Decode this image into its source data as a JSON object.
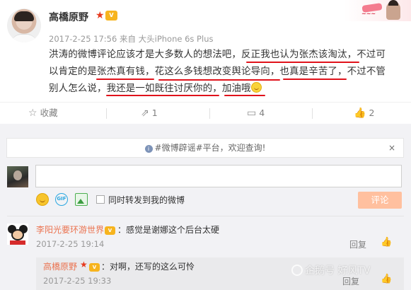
{
  "post": {
    "user_name": "高橋原野",
    "meta": "2017-2-25 17:56 来自 大头iPhone 6s Plus",
    "lines": [
      [
        "洪涛的微博评论应该才是大多数人的想法吧，",
        "反正我也认为张杰该淘汰",
        "，不过可"
      ],
      [
        "以肯定的是",
        "张杰真有钱",
        "，",
        "花这么多钱想改变舆论导向",
        "，",
        "也真是辛苦了",
        "，不过不管"
      ],
      [
        "别人怎么说，",
        "我还是一如既往讨厌你的",
        "，",
        "加油哦"
      ]
    ],
    "actions": {
      "favorite_label": "收藏",
      "repost_count": "1",
      "comment_count": "4",
      "like_count": "2"
    }
  },
  "notice": {
    "text": "#微博辟谣#平台，欢迎查询!",
    "close": "×"
  },
  "composer": {
    "gif_label": "GIF",
    "repost_label": "同时转发到我的微博",
    "submit_label": "评论"
  },
  "comments": [
    {
      "user": "李阳光要环游世界",
      "text": "：感觉是谢娜这个后台太硬",
      "time": "2017-2-25 19:14",
      "reply_label": "回复"
    },
    {
      "user": "高橋原野",
      "text": "：对啊，还写的这么可怜",
      "time": "2017-2-25 19:33",
      "reply_label": "回复"
    }
  ],
  "watermark": "企鹅号 好风TV",
  "colors": {
    "accent_orange": "#eb7350",
    "underline_red": "#e0121b",
    "submit_disabled": "#ffc09f"
  }
}
